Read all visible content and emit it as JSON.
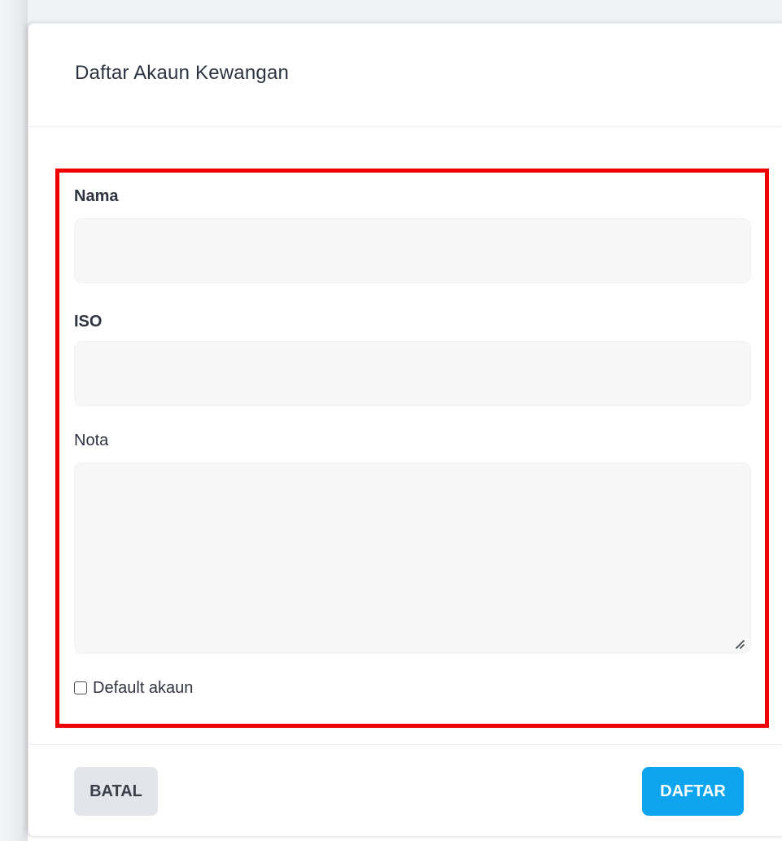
{
  "modal": {
    "title": "Daftar Akaun Kewangan"
  },
  "form": {
    "name_label": "Nama",
    "name_value": "",
    "iso_label": "ISO",
    "iso_value": "",
    "note_label": "Nota",
    "note_value": "",
    "default_account_label": "Default akaun",
    "default_account_checked": false
  },
  "footer": {
    "cancel_label": "BATAL",
    "submit_label": "DAFTAR"
  },
  "colors": {
    "highlight_border": "#ee0000",
    "submit_button": "#0ea5ee",
    "cancel_button": "#e2e5ea",
    "input_background": "#f7f7f8"
  },
  "icons": {
    "textarea_resize": "resize-grip-icon"
  }
}
